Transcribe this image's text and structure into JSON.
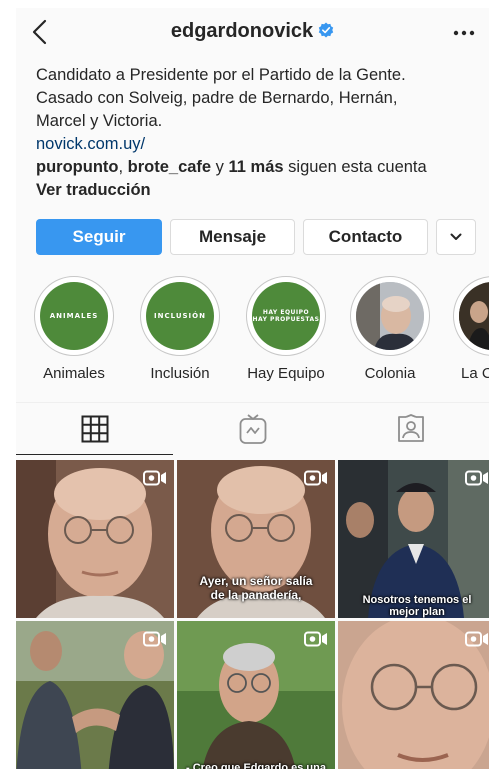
{
  "header": {
    "username": "edgardonovick",
    "verified_icon": "verified-badge-icon",
    "more_icon": "more-dots-icon",
    "back_icon": "back-chevron-icon"
  },
  "bio": {
    "line1": "Candidato a Presidente por el Partido de la Gente.",
    "line2": "Casado con Solveig, padre de Bernardo, Hernán,",
    "line3": "Marcel y Victoria.",
    "link": "novick.com.uy/",
    "followers_a": "puropunto",
    "followers_sep1": ", ",
    "followers_b": "brote_cafe",
    "followers_sep2": " y ",
    "followers_count": "11 más",
    "followers_suffix": " siguen esta cuenta",
    "translate": "Ver traducción"
  },
  "buttons": {
    "follow": "Seguir",
    "message": "Mensaje",
    "contact": "Contacto",
    "more_icon": "chevron-down-icon"
  },
  "highlights": [
    {
      "label": "Animales",
      "cover_text": "ANIMALES"
    },
    {
      "label": "Inclusión",
      "cover_text": "INCLUSIÓN"
    },
    {
      "label": "Hay Equipo",
      "cover_line1": "HAY EQUIPO",
      "cover_line2": "HAY PROPUESTAS"
    },
    {
      "label": "Colonia"
    },
    {
      "label": "La C"
    }
  ],
  "tabs": [
    {
      "name": "grid",
      "icon": "grid-icon",
      "active": true
    },
    {
      "name": "igtv",
      "icon": "igtv-icon",
      "active": false
    },
    {
      "name": "tagged",
      "icon": "tagged-icon",
      "active": false
    }
  ],
  "posts": {
    "p2_caption_1": "Ayer, un señor salía",
    "p2_caption_2": "de la panadería,",
    "p3_caption_1": "Nosotros tenemos el",
    "p3_caption_2": "mejor plan",
    "p5_caption": "- Creo que Edgardo es una"
  },
  "colors": {
    "accent": "#3897f0",
    "text": "#262626",
    "link": "#00376b",
    "highlight_green": "#4e8a3a"
  }
}
